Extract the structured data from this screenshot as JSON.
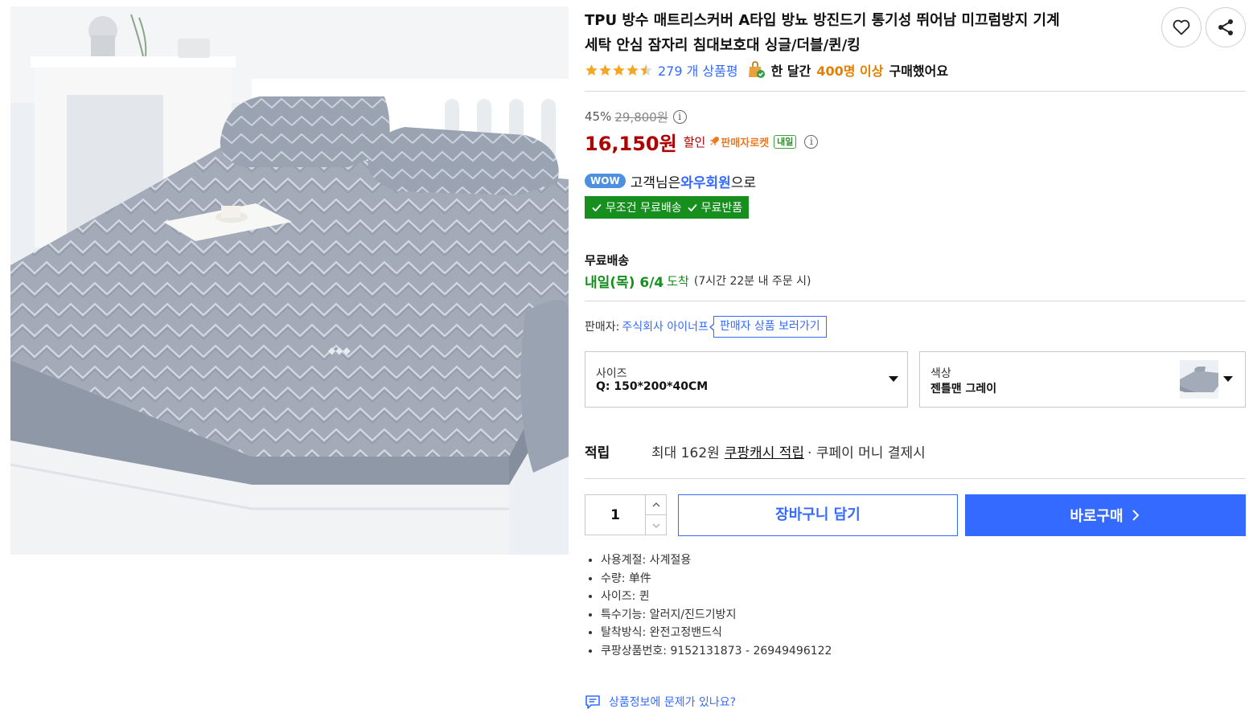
{
  "product": {
    "title_line1": "TPU 방수 매트리스커버 A타입 방뇨 방진드기 통기성 뛰어남 미끄럼방지 기계",
    "title_line2": "세탁 안심 잠자리 침대보호대 싱글/더블/퀸/킹",
    "image_icon": "product-photo-grey-quilted-mattress-cover"
  },
  "actions": {
    "wishlist_icon": "heart-icon",
    "share_icon": "share-icon"
  },
  "rating": {
    "stars": 4.5,
    "review_count": "279 개 상품평",
    "bought_pre": "한 달간",
    "bought_num": "400명 이상",
    "bought_post": "구매했어요"
  },
  "price": {
    "discount_rate": "45%",
    "original_price": "29,800원",
    "sale_price": "16,150원",
    "sale_label": "할인",
    "rocket_label": "판매자로켓",
    "tomorrow_badge": "내일",
    "info_icon_glyph": "i"
  },
  "membership": {
    "badge": "WOW",
    "text_pre": "고객님은",
    "text_strong": "와우회원",
    "text_post": "으로",
    "free_shipping": "무조건 무료배송",
    "free_return": "무료반품"
  },
  "shipping": {
    "label": "무료배송",
    "date": "내일(목) 6/4",
    "arrive": "도착",
    "note": "(7시간 22분 내 주문 시)"
  },
  "seller": {
    "label": "판매자:",
    "name": "주식회사 아이너프",
    "button": "판매자 상품 보러가기"
  },
  "options": {
    "size_label": "사이즈",
    "size_value": "Q: 150*200*40CM",
    "color_label": "색상",
    "color_value": "젠틀맨 그레이"
  },
  "reward": {
    "label": "적립",
    "text": "최대 162원",
    "link": "쿠팡캐시 적립",
    "post": "· 쿠페이 머니 결제시"
  },
  "purchase": {
    "quantity": "1",
    "cart_button": "장바구니 담기",
    "buy_button": "바로구매"
  },
  "attributes": [
    "사용계절: 사계절용",
    "수량: 单件",
    "사이즈: 퀸",
    "특수기능: 알러지/진드기방지",
    "탈착방식: 완전고정밴드식",
    "쿠팡상품번호: 9152131873 - 26949496122"
  ],
  "report": {
    "text": "상품정보에 문제가 있나요?"
  },
  "colors": {
    "accent_blue": "#346aff",
    "price_red": "#ae0000",
    "rocket_orange": "#f2781e",
    "free_green": "#168f1e",
    "bought_orange": "#e67e00",
    "star_orange": "#f5a623"
  }
}
